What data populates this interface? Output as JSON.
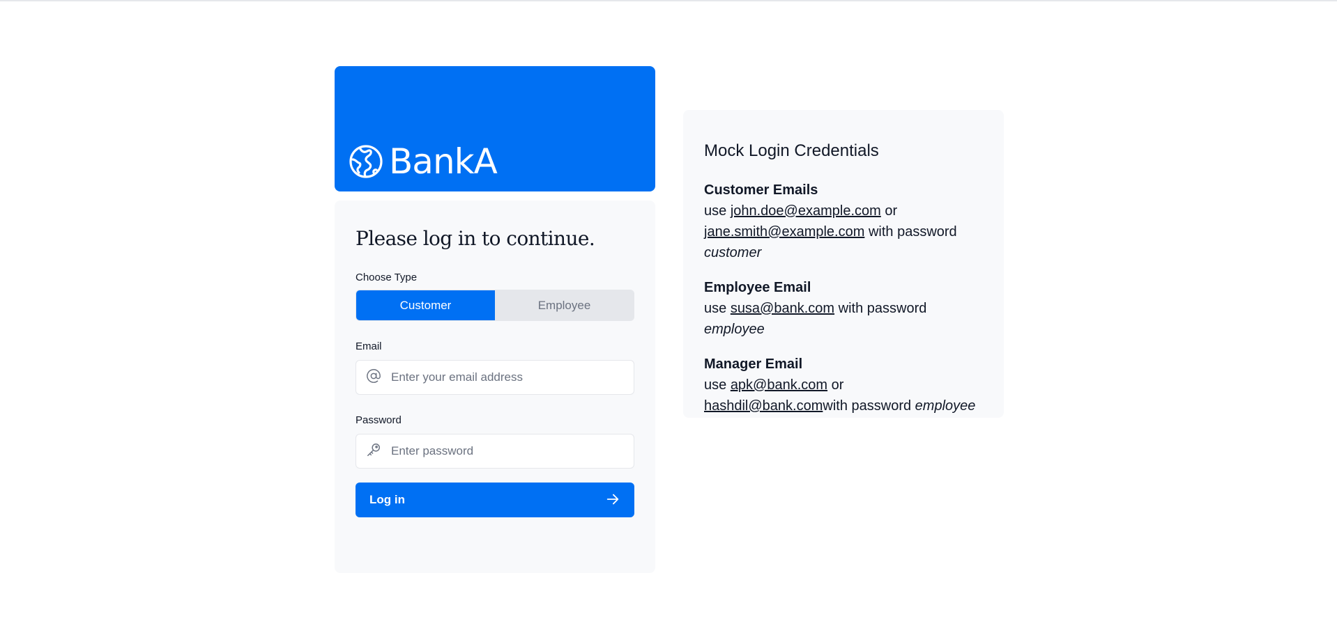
{
  "brand": {
    "name": "BankA",
    "logo_icon": "globe-icon",
    "banner_color": "#0070f3"
  },
  "login": {
    "heading": "Please log in to continue.",
    "type_label": "Choose Type",
    "types": [
      "Customer",
      "Employee"
    ],
    "selected_type": "Customer",
    "email_label": "Email",
    "email_placeholder": "Enter your email address",
    "email_icon": "at-sign-icon",
    "password_label": "Password",
    "password_placeholder": "Enter password",
    "password_icon": "key-icon",
    "submit_label": "Log in",
    "submit_icon": "arrow-right-icon"
  },
  "credentials": {
    "title": "Mock Login Credentials",
    "customer": {
      "heading": "Customer Emails",
      "prefix": "use",
      "email1": "john.doe@example.com",
      "connector": "or",
      "email2": "jane.smith@example.com",
      "with_password": "with password",
      "password": "customer"
    },
    "employee": {
      "heading": "Employee Email",
      "prefix": "use",
      "email": "susa@bank.com",
      "with_password": "with password",
      "password": "employee"
    },
    "manager": {
      "heading": "Manager Email",
      "prefix": "use",
      "email1": "apk@bank.com",
      "connector": "or",
      "email2": "hashdil@bank.com",
      "with_password": "with password",
      "password": "employee"
    }
  },
  "colors": {
    "accent": "#0070f3",
    "card_bg": "#f8f9fb",
    "toggle_inactive_bg": "#e5e7eb"
  }
}
